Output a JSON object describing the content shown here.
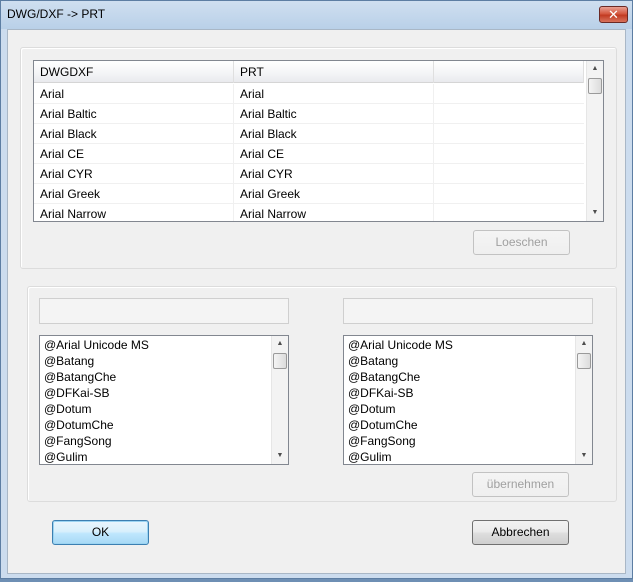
{
  "window": {
    "title": "DWG/DXF -> PRT",
    "close_label": "✕"
  },
  "mapping_table": {
    "columns": [
      "DWGDXF",
      "PRT"
    ],
    "rows": [
      [
        "Arial",
        "Arial"
      ],
      [
        "Arial Baltic",
        "Arial Baltic"
      ],
      [
        "Arial Black",
        "Arial Black"
      ],
      [
        "Arial CE",
        "Arial CE"
      ],
      [
        "Arial CYR",
        "Arial CYR"
      ],
      [
        "Arial Greek",
        "Arial Greek"
      ],
      [
        "Arial Narrow",
        "Arial Narrow"
      ]
    ],
    "delete_button": "Loeschen"
  },
  "left_font_list": {
    "input_value": "",
    "items": [
      "@Arial Unicode MS",
      "@Batang",
      "@BatangChe",
      "@DFKai-SB",
      "@Dotum",
      "@DotumChe",
      "@FangSong",
      "@Gulim"
    ]
  },
  "right_font_list": {
    "input_value": "",
    "items": [
      "@Arial Unicode MS",
      "@Batang",
      "@BatangChe",
      "@DFKai-SB",
      "@Dotum",
      "@DotumChe",
      "@FangSong",
      "@Gulim"
    ]
  },
  "apply_button": "übernehmen",
  "footer": {
    "ok_label": "OK",
    "cancel_label": "Abbrechen"
  },
  "scrollbar": {
    "up_icon": "▲",
    "down_icon": "▼"
  }
}
